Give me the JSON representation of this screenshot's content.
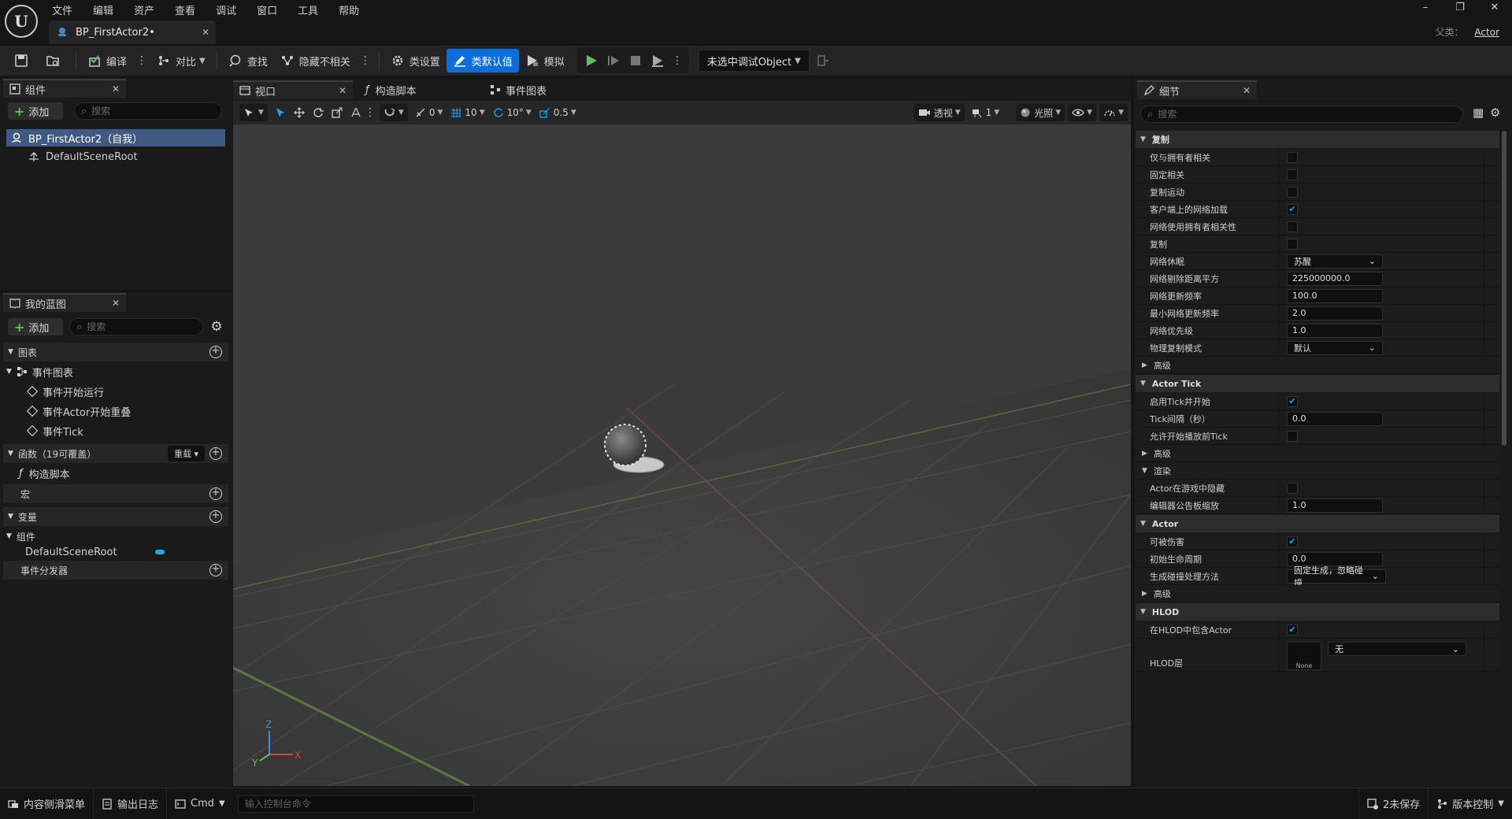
{
  "menubar": [
    "文件",
    "编辑",
    "资产",
    "查看",
    "调试",
    "窗口",
    "工具",
    "帮助"
  ],
  "document_tab": {
    "title": "BP_FirstActor2•"
  },
  "parent_class": {
    "label": "父类：",
    "value": "Actor"
  },
  "toolbar": {
    "compile": "编译",
    "diff": "对比",
    "find": "查找",
    "hide_unrelated": "隐藏不相关",
    "class_settings": "类设置",
    "class_defaults": "类默认值",
    "simulate": "模拟",
    "debug_object": "未选中调试Object"
  },
  "components": {
    "tab_label": "组件",
    "add_label": "添加",
    "search_placeholder": "搜索",
    "root": "BP_FirstActor2（自我）",
    "child": "DefaultSceneRoot"
  },
  "my_blueprint": {
    "tab_label": "我的蓝图",
    "add_label": "添加",
    "search_placeholder": "搜索",
    "graphs_header": "图表",
    "event_graph": "事件图表",
    "events": [
      "事件开始运行",
      "事件Actor开始重叠",
      "事件Tick"
    ],
    "functions_header": "函数（19可覆盖）",
    "override_label": "重载",
    "construction_script": "构造脚本",
    "macros_header": "宏",
    "variables_header": "变量",
    "components_group": "组件",
    "variable_item": "DefaultSceneRoot",
    "dispatchers_header": "事件分发器"
  },
  "viewport": {
    "tabs": [
      "视口",
      "构造脚本",
      "事件图表"
    ],
    "toolbar": {
      "rot_snap": "0",
      "grid_snap": "10",
      "angle_snap": "10°",
      "scale_snap": "0.5",
      "perspective": "透视",
      "camera_speed": "1",
      "lighting": "光照"
    },
    "axis_labels": {
      "x": "X",
      "y": "Y",
      "z": "Z"
    }
  },
  "details": {
    "tab_label": "细节",
    "search_placeholder": "搜索",
    "sections": {
      "replication": "复制",
      "actor_tick": "Actor Tick",
      "rendering": "渲染",
      "actor": "Actor",
      "hlod": "HLOD",
      "advanced": "高级"
    },
    "rows": {
      "only_relevant_to_owner": "仅与拥有者相关",
      "always_relevant": "固定相关",
      "replicate_movement": "复制运动",
      "net_load_on_client": "客户端上的网络加载",
      "net_use_owner_relevancy": "网络使用拥有者相关性",
      "replicates": "复制",
      "net_dormancy": "网络休眠",
      "net_dormancy_value": "苏醒",
      "net_cull_distance": "网络剔除距离平方",
      "net_cull_distance_value": "225000000.0",
      "net_update_freq": "网络更新频率",
      "net_update_freq_value": "100.0",
      "min_net_update_freq": "最小网络更新频率",
      "min_net_update_freq_value": "2.0",
      "net_priority": "网络优先级",
      "net_priority_value": "1.0",
      "physics_rep_mode": "物理复制模式",
      "physics_rep_mode_value": "默认",
      "start_with_tick": "启用Tick并开始",
      "tick_interval": "Tick间隔（秒）",
      "tick_interval_value": "0.0",
      "tick_before_begin_play": "允许开始播放前Tick",
      "actor_hidden_in_game": "Actor在游戏中隐藏",
      "editor_billboard_scale": "编辑器公告板缩放",
      "editor_billboard_scale_value": "1.0",
      "can_be_damaged": "可被伤害",
      "initial_lifespan": "初始生命周期",
      "initial_lifespan_value": "0.0",
      "spawn_collision": "生成碰撞处理方法",
      "spawn_collision_value": "固定生成，忽略碰撞",
      "include_in_hlod": "在HLOD中包含Actor",
      "hlod_layer": "HLOD层",
      "hlod_layer_thumb": "None",
      "hlod_layer_value": "无"
    }
  },
  "statusbar": {
    "content_drawer": "内容侧滑菜单",
    "output_log": "输出日志",
    "cmd": "Cmd",
    "cmd_placeholder": "输入控制台命令",
    "unsaved": "2未保存",
    "source_control": "版本控制"
  },
  "colors": {
    "accent": "#0d6edb",
    "checkbox": "#1fa3f2",
    "play": "#59c354",
    "selection": "#3f5a82"
  }
}
